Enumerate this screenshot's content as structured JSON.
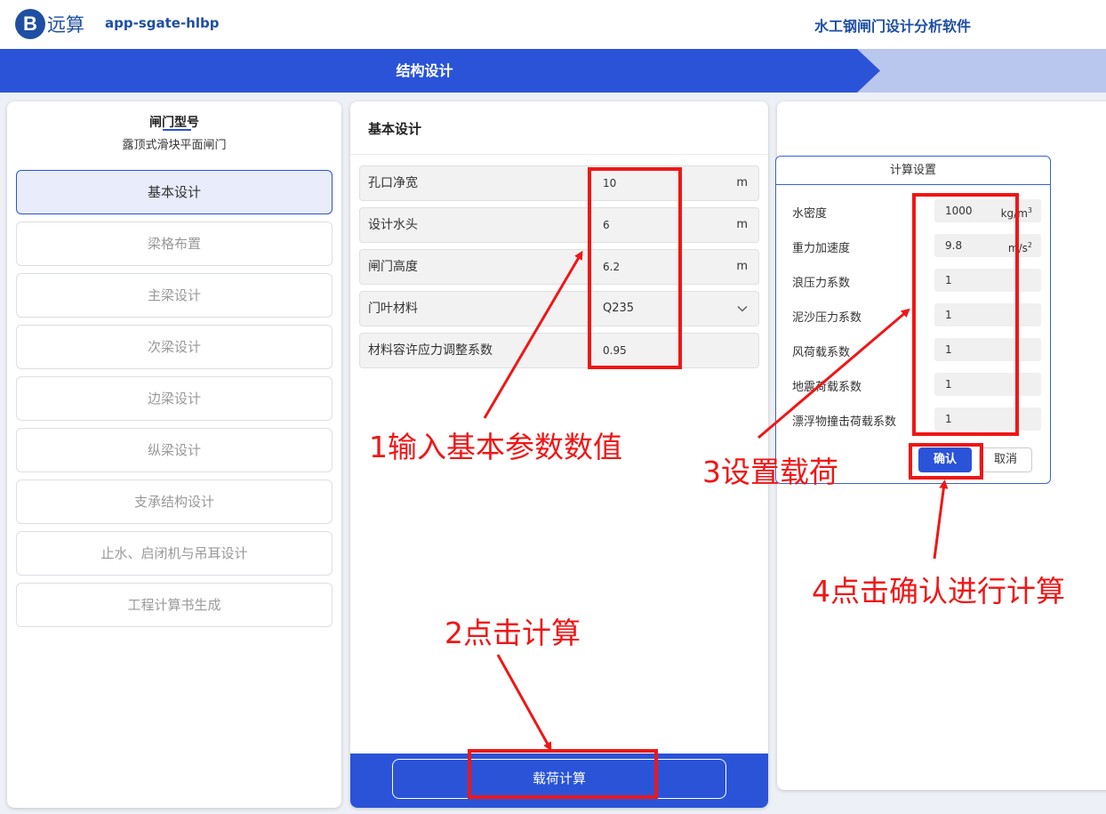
{
  "header": {
    "logo_letter": "B",
    "brand": "远算",
    "app_name": "app-sgate-hlbp",
    "software_title": "水工钢闸门设计分析软件"
  },
  "stepbar": {
    "current_step": "结构设计",
    "colors": {
      "active": "#2a53d8",
      "inactive": "#b9c6ee"
    }
  },
  "sidebar": {
    "title": "闸门型号",
    "gate_type": "露顶式滑块平面闸门",
    "items": [
      {
        "label": "基本设计",
        "active": true
      },
      {
        "label": "梁格布置",
        "active": false
      },
      {
        "label": "主梁设计",
        "active": false
      },
      {
        "label": "次梁设计",
        "active": false
      },
      {
        "label": "边梁设计",
        "active": false
      },
      {
        "label": "纵梁设计",
        "active": false
      },
      {
        "label": "支承结构设计",
        "active": false
      },
      {
        "label": "止水、启闭机与吊耳设计",
        "active": false
      },
      {
        "label": "工程计算书生成",
        "active": false
      }
    ]
  },
  "basic": {
    "title": "基本设计",
    "params": [
      {
        "label": "孔口净宽",
        "value": "10",
        "unit": "m"
      },
      {
        "label": "设计水头",
        "value": "6",
        "unit": "m"
      },
      {
        "label": "闸门高度",
        "value": "6.2",
        "unit": "m"
      },
      {
        "label": "门叶材料",
        "value": "Q235",
        "icon": "chevron-down-icon"
      },
      {
        "label": "材料容许应力调整系数",
        "value": "0.95"
      }
    ],
    "calc_button": "载荷计算"
  },
  "dialog": {
    "title": "计算设置",
    "rows": [
      {
        "label": "水密度",
        "value": "1000",
        "unit": "kg/m",
        "sup": "3"
      },
      {
        "label": "重力加速度",
        "value": "9.8",
        "unit": "m/s",
        "sup": "2"
      },
      {
        "label": "浪压力系数",
        "value": "1"
      },
      {
        "label": "泥沙压力系数",
        "value": "1"
      },
      {
        "label": "风荷载系数",
        "value": "1"
      },
      {
        "label": "地震荷载系数",
        "value": "1"
      },
      {
        "label": "漂浮物撞击荷载系数",
        "value": "1"
      }
    ],
    "confirm": "确认",
    "cancel": "取消"
  },
  "annotations": {
    "step1": "1输入基本参数数值",
    "step2": "2点击计算",
    "step3": "3设置载荷",
    "step4": "4点击确认进行计算",
    "color": "#f01616"
  }
}
